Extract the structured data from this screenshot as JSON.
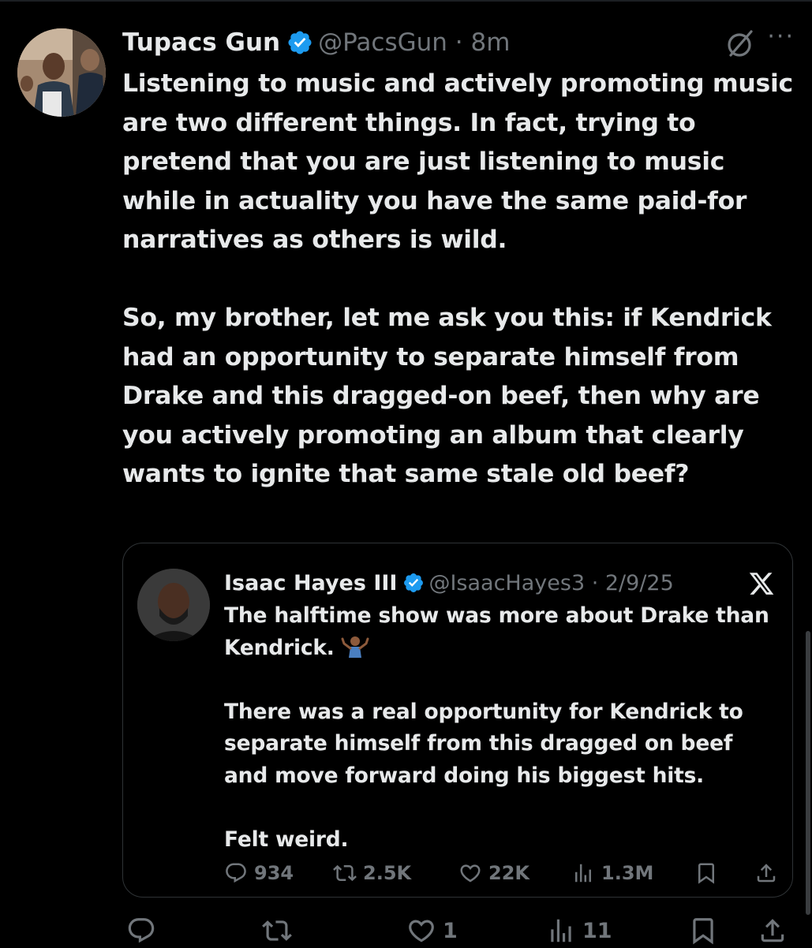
{
  "post": {
    "author_name": "Tupacs Gun",
    "handle_time": "@PacsGun · 8m",
    "paragraphs": [
      "Listening to music and actively promoting music are two different things. In fact, trying to pretend that you are just listening to music while in actuality you have the same paid-for narratives as others is wild.",
      "So, my brother, let me ask you this: if Kendrick had an opportunity to separate himself from Drake and this dragged-on beef, then why are you actively promoting an album that clearly wants to ignite that same stale old beef?"
    ],
    "stats": {
      "replies": "",
      "reposts": "",
      "likes": "1",
      "views": "11"
    },
    "more_label": "···"
  },
  "quote": {
    "author_name": "Isaac Hayes III",
    "handle_time": "@IsaacHayes3 · 2/9/25",
    "paragraphs": [
      "The halftime show was more about Drake than Kendrick.",
      "There was a real opportunity for Kendrick to separate himself from this dragged on beef and move forward doing his biggest hits.",
      "Felt weird."
    ],
    "stats": {
      "replies": "934",
      "reposts": "2.5K",
      "likes": "22K",
      "views": "1.3M"
    }
  },
  "colors": {
    "background": "#000000",
    "text": "#e7e9ea",
    "muted": "#71767b",
    "verified": "#1d9bf0",
    "border": "#2f3336"
  }
}
